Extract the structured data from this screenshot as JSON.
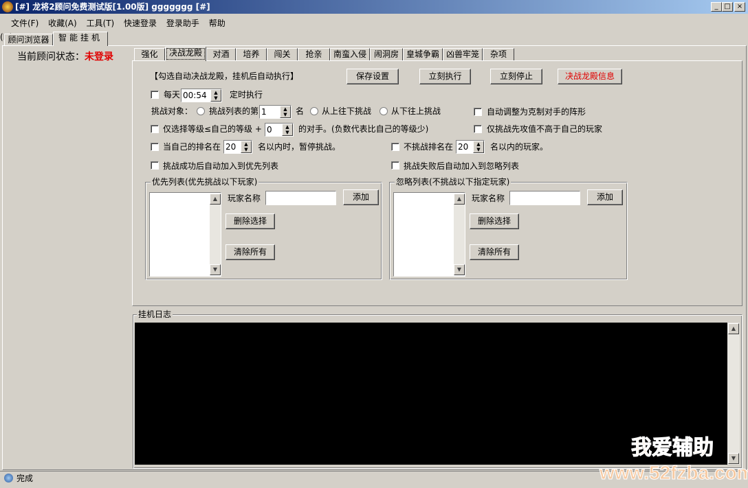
{
  "window": {
    "title": "[#] 龙将2顾问免费测试版[1.00版] ggggggg [#]",
    "min": "_",
    "max": "□",
    "close": "×"
  },
  "menu": [
    "文件(F)",
    "收藏(A)",
    "工具(T)",
    "快速登录",
    "登录助手",
    "帮助(H)"
  ],
  "outer_tabs": [
    "顾问浏览器",
    "智能挂机"
  ],
  "status": {
    "label": "当前顾问状态：",
    "value": "未登录",
    "value_color": "#e00000"
  },
  "inner_tabs": [
    "强化",
    "决战龙殿",
    "对酒",
    "培养",
    "闯关",
    "抢亲",
    "南蛮入侵",
    "闹洞房",
    "皇城争霸",
    "凶兽牢笼",
    "杂项"
  ],
  "panel": {
    "hint": "【勾选自动决战龙殿，挂机后自动执行】",
    "buttons": {
      "save": "保存设置",
      "run": "立刻执行",
      "stop": "立刻停止",
      "info": "决战龙殿信息"
    },
    "daily": {
      "label": "每天",
      "time": "00:54",
      "suffix": "定时执行"
    },
    "target": {
      "label": "挑战对象：",
      "opt1": "挑战列表的第",
      "rank": "1",
      "unit": "名",
      "opt2": "从上往下挑战",
      "opt3": "从下往上挑战"
    },
    "auto_adjust": "自动调整为克制对手的阵形",
    "level": {
      "label": "仅选择等级≤自己的等级 +",
      "value": "0",
      "suffix": "的对手。(负数代表比自己的等级少)"
    },
    "attack_only": "仅挑战先攻值不高于自己的玩家",
    "pause": {
      "label": "当自己的排名在",
      "value": "20",
      "suffix": "名以内时，暂停挑战。"
    },
    "skip": {
      "label": "不挑战排名在",
      "value": "20",
      "suffix": "名以内的玩家。"
    },
    "win_add": "挑战成功后自动加入到优先列表",
    "lose_add": "挑战失败后自动加入到忽略列表",
    "priority": {
      "title": "优先列表(优先挑战以下玩家)",
      "name_label": "玩家名称",
      "name_value": "",
      "add": "添加",
      "delete": "删除选择",
      "clear": "清除所有"
    },
    "ignore": {
      "title": "忽略列表(不挑战以下指定玩家)",
      "name_label": "玩家名称",
      "name_value": "",
      "add": "添加",
      "delete": "删除选择",
      "clear": "清除所有"
    }
  },
  "log": {
    "title": "挂机日志"
  },
  "statusbar": {
    "text": "完成"
  },
  "watermark": {
    "line1": "我爱辅助",
    "line2": "www.52fzba.com"
  }
}
